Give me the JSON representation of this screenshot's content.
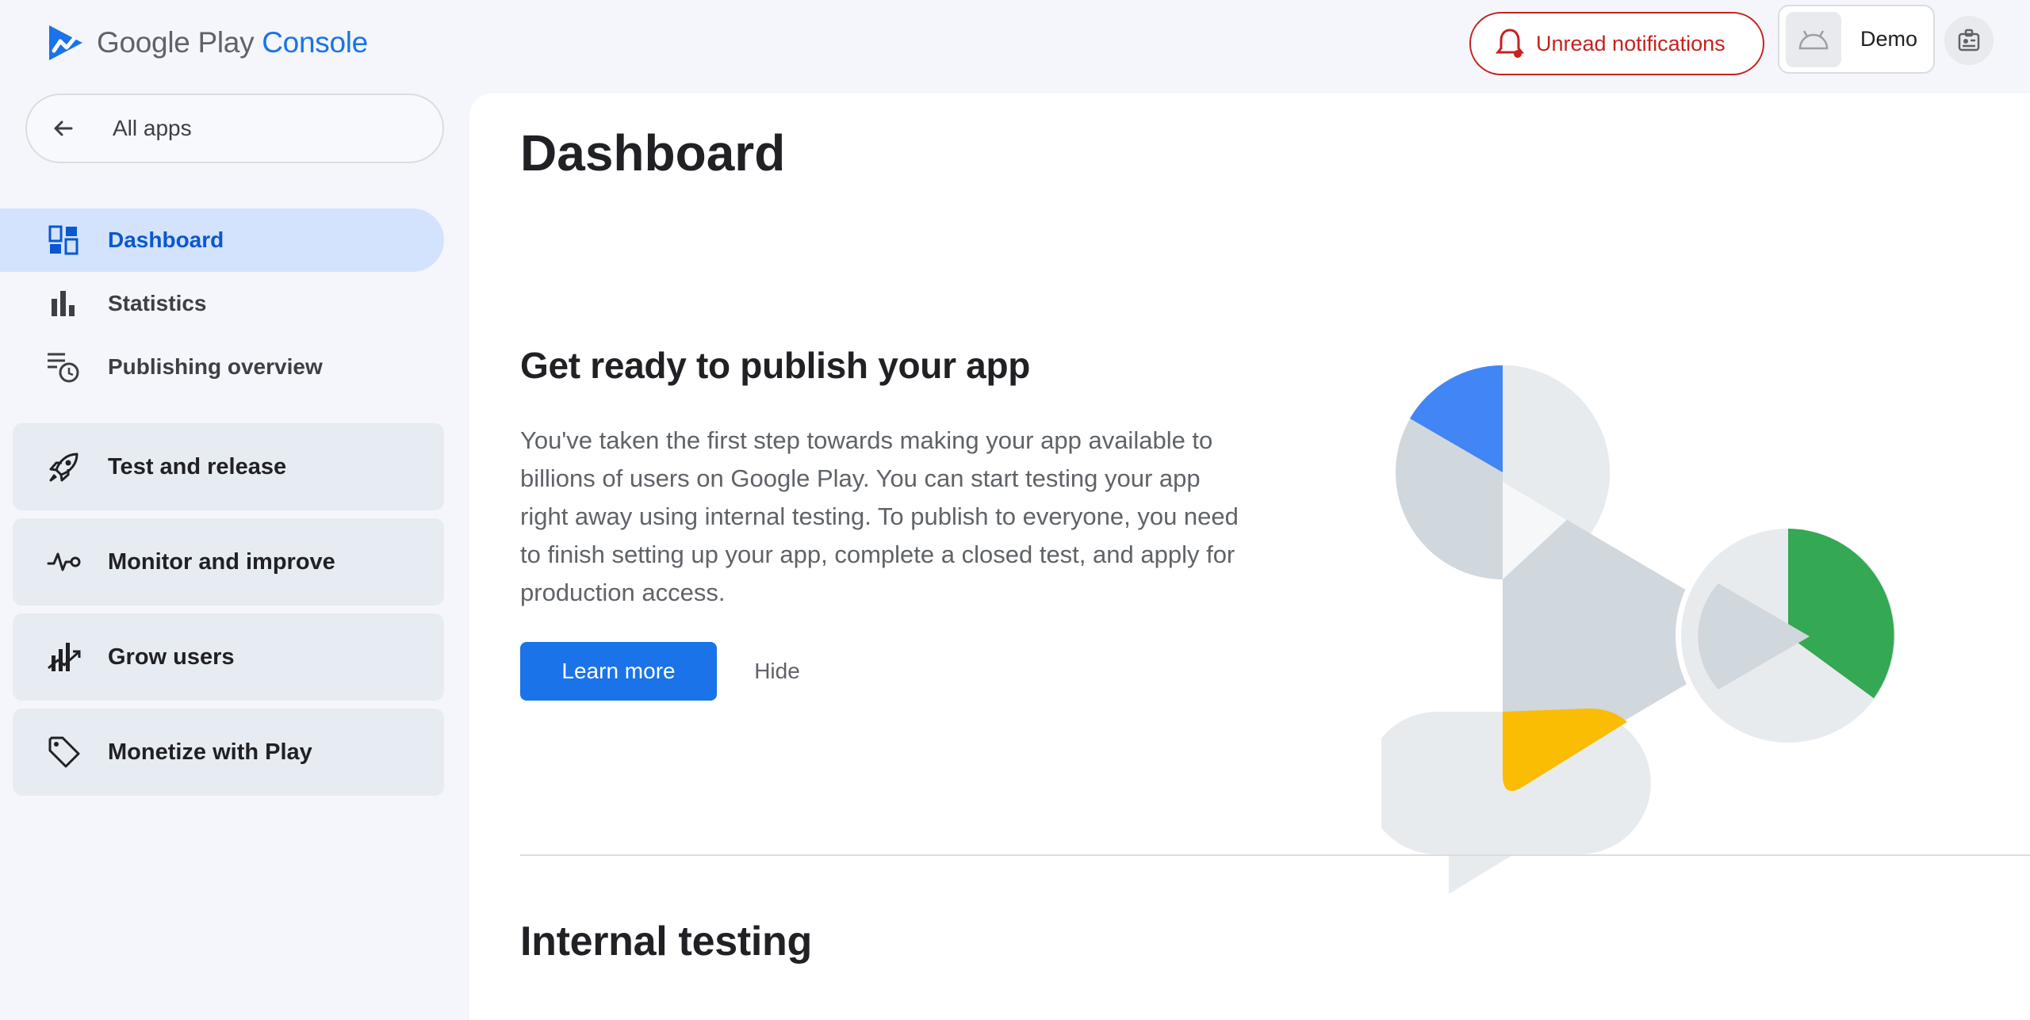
{
  "header": {
    "logo_brand": "Google Play",
    "logo_product": "Console",
    "notifications_label": "Unread notifications",
    "app_name": "Demo"
  },
  "sidebar": {
    "all_apps_label": "All apps",
    "items": [
      {
        "label": "Dashboard",
        "icon": "dashboard-icon",
        "active": true
      },
      {
        "label": "Statistics",
        "icon": "bar-chart-icon"
      },
      {
        "label": "Publishing overview",
        "icon": "publishing-overview-icon"
      }
    ],
    "groups": [
      {
        "label": "Test and release",
        "icon": "rocket-icon"
      },
      {
        "label": "Monitor and improve",
        "icon": "vitals-icon"
      },
      {
        "label": "Grow users",
        "icon": "grow-users-icon"
      },
      {
        "label": "Monetize with Play",
        "icon": "tag-icon"
      }
    ]
  },
  "main": {
    "title": "Dashboard",
    "promo": {
      "heading": "Get ready to publish your app",
      "body": "You've taken the first step towards making your app available to billions of users on Google Play. You can start testing your app right away using internal testing. To publish to everyone, you need to finish setting up your app, complete a closed test, and apply for production access.",
      "learn_more_label": "Learn more",
      "hide_label": "Hide"
    },
    "next_section_title": "Internal testing"
  },
  "colors": {
    "accent": "#1a73e8",
    "active_nav_bg": "#d3e3fd",
    "notification": "#c5221f",
    "illustration_blue": "#4285f4",
    "illustration_green": "#34a853",
    "illustration_yellow": "#fbbc04"
  }
}
